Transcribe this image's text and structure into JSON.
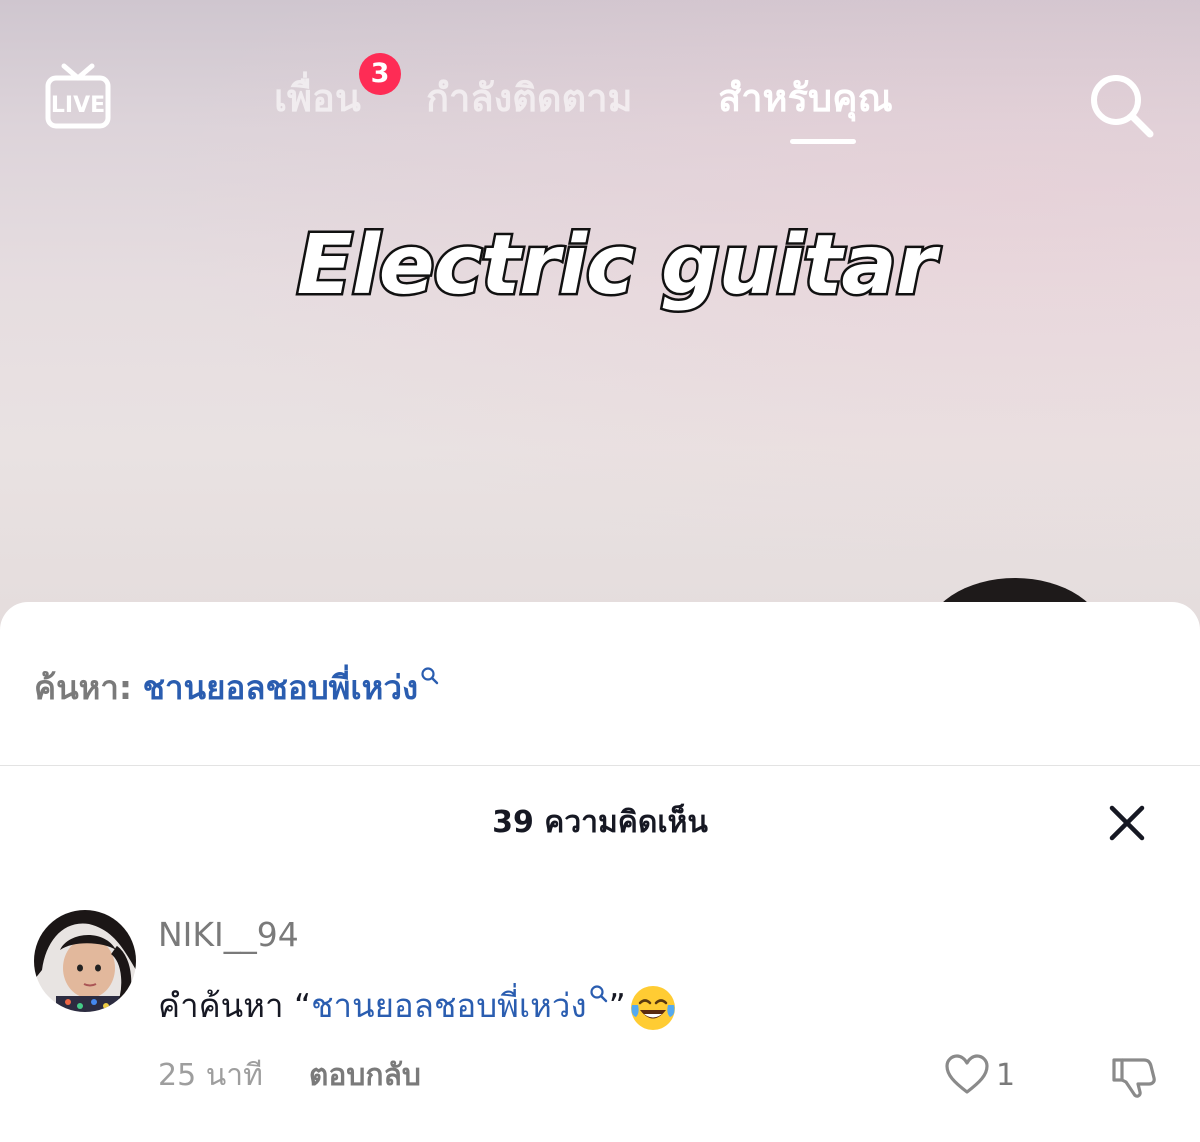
{
  "topbar": {
    "live_label": "LIVE",
    "tabs": [
      {
        "label": "เพื่อน",
        "badge": "3"
      },
      {
        "label": "กำลังติดตาม"
      },
      {
        "label": "สำหรับคุณ",
        "active": true
      }
    ]
  },
  "video": {
    "overlay_text": "Electric guitar"
  },
  "search_suggestion": {
    "label": "ค้นหา:",
    "term": "ชานยอลชอบพี่เหว่ง"
  },
  "comments_header": {
    "title": "39 ความคิดเห็น"
  },
  "comment": {
    "username": "NIKI__94",
    "text_prefix": "คำค้นหา “",
    "text_link": "ชานยอลชอบพี่เหว่ง",
    "text_suffix": "”",
    "time": "25 นาที",
    "reply_label": "ตอบกลับ",
    "like_count": "1"
  },
  "icons": {
    "live": "live-tv-icon",
    "search": "search-icon",
    "close": "close-icon",
    "like": "heart-icon",
    "dislike": "thumbs-down-icon",
    "emoji": "tears-of-joy-emoji"
  },
  "colors": {
    "accent_badge": "#fe2c55",
    "link": "#2a5db0"
  }
}
